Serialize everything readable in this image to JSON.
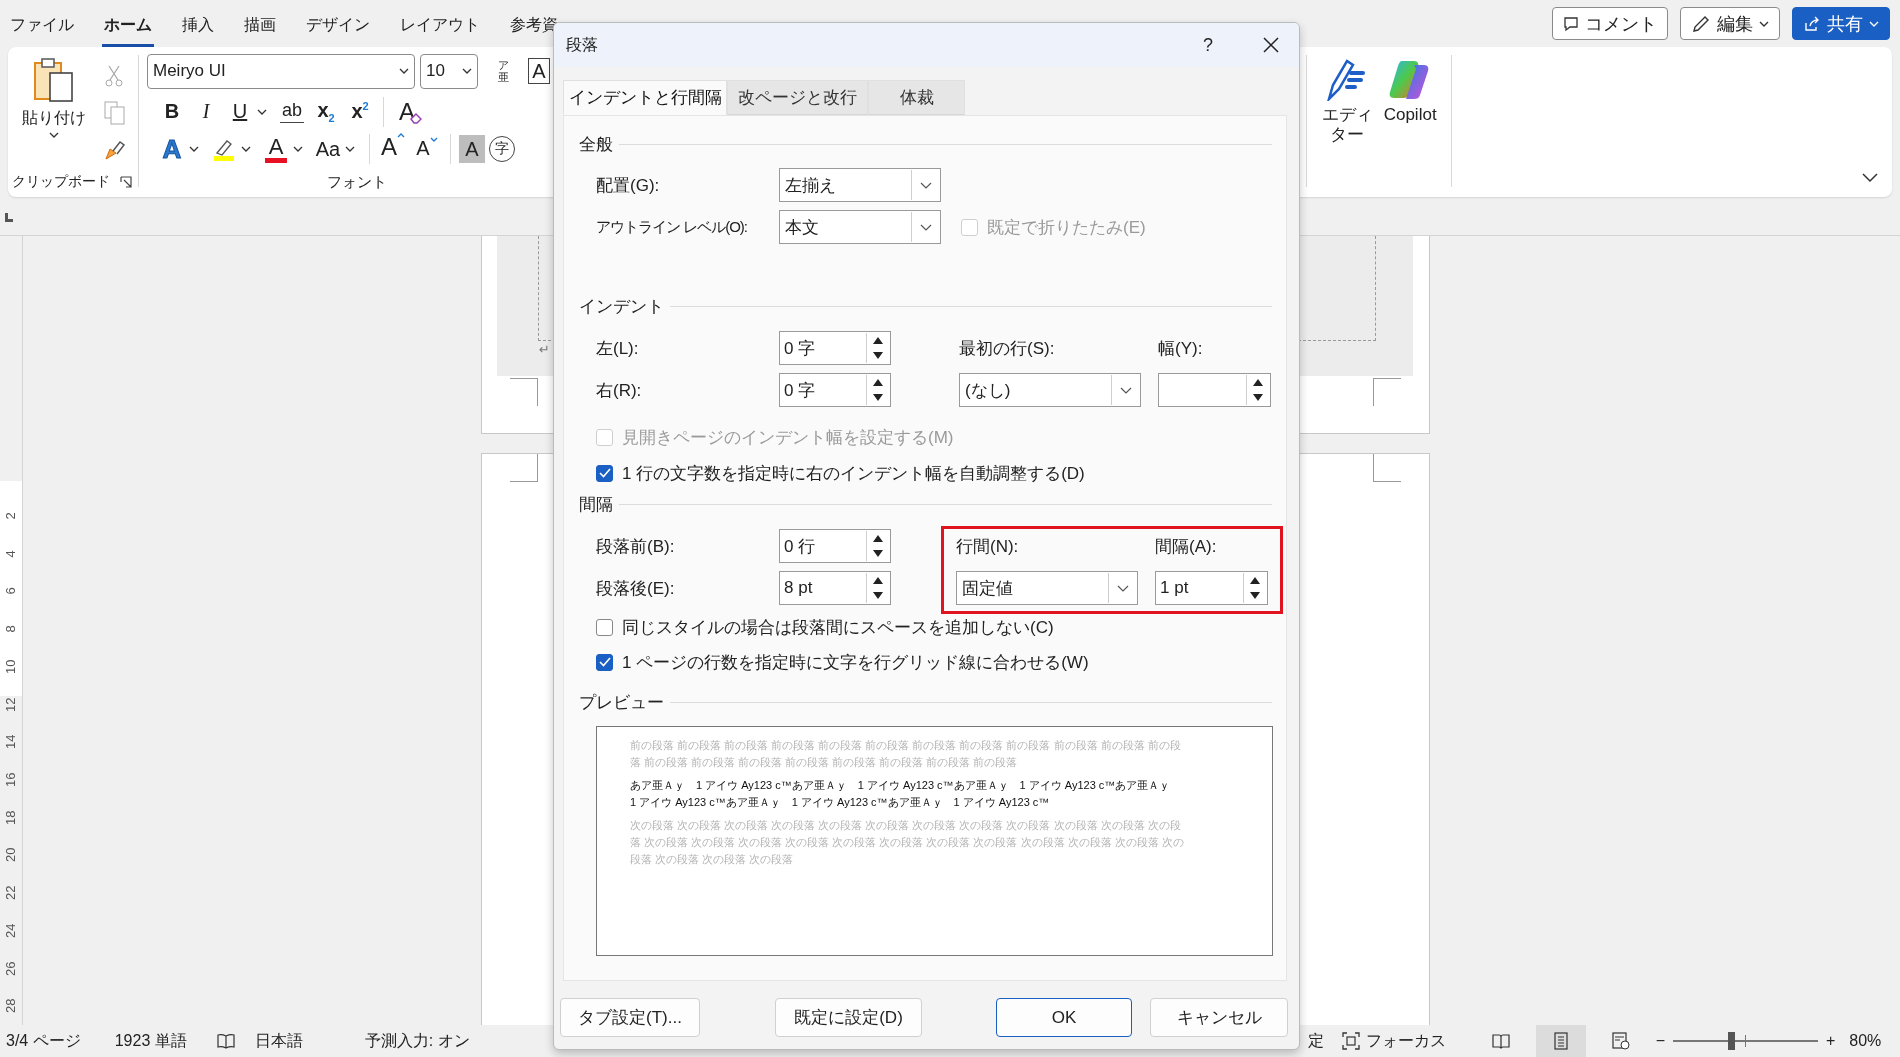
{
  "menu_tabs": [
    {
      "label": "ファイル",
      "selected": false
    },
    {
      "label": "ホーム",
      "selected": true
    },
    {
      "label": "挿入",
      "selected": false
    },
    {
      "label": "描画",
      "selected": false
    },
    {
      "label": "デザイン",
      "selected": false
    },
    {
      "label": "レイアウト",
      "selected": false
    },
    {
      "label": "参考資",
      "selected": false
    }
  ],
  "top_buttons": [
    {
      "kind": "comment",
      "label": "コメント"
    },
    {
      "kind": "edit",
      "label": "編集"
    },
    {
      "kind": "share",
      "label": "共有"
    }
  ],
  "ribbon": {
    "clipboard": {
      "paste": "貼り付け",
      "group_label": "クリップボード"
    },
    "font": {
      "font_name": "Meiryo UI",
      "font_size": "10",
      "ruby_top": "ア",
      "ruby_bottom": "亜",
      "border_label": "A",
      "group_label": "フォント",
      "row_1": [
        {
          "kind": "bold",
          "label": "B",
          "dropdown": false
        },
        {
          "kind": "italic",
          "label": "I",
          "dropdown": false
        },
        {
          "kind": "underline",
          "label": "U",
          "dropdown": true
        },
        {
          "kind": "strike",
          "label": "ab",
          "dropdown": false
        },
        {
          "kind": "subscript",
          "label": "x$_{2}$",
          "dropdown": false
        },
        {
          "kind": "superscript",
          "label": "x$^{2}$",
          "dropdown": false
        },
        {
          "kind": "clear",
          "label": "A",
          "dropdown": false
        }
      ],
      "row_2": [
        {
          "kind": "effects",
          "label": "A",
          "dropdown": true
        },
        {
          "kind": "highlight",
          "dropdown": true
        },
        {
          "kind": "color",
          "label": "A",
          "dropdown": true
        },
        {
          "kind": "case",
          "label": "Aa",
          "dropdown": true
        },
        {
          "kind": "grow",
          "label": "A",
          "dropdown": false
        },
        {
          "kind": "shrink",
          "label": "A",
          "dropdown": false
        },
        {
          "kind": "shade",
          "label": "A",
          "dropdown": false
        },
        {
          "kind": "enclose",
          "label": "字",
          "dropdown": false
        }
      ]
    },
    "editor": "エディター",
    "copilot": "Copilot"
  },
  "document": {
    "paragraph_mark": "↵",
    "ruler_numbers": [
      "2",
      "4",
      "6",
      "8",
      "10",
      "12",
      "14",
      "16",
      "18",
      "20",
      "22",
      "24",
      "26",
      "28"
    ]
  },
  "dialog": {
    "title": "段落",
    "help": "?",
    "tabs": [
      {
        "label": "インデントと行間隔",
        "selected": true
      },
      {
        "label": "改ページと改行",
        "selected": false
      },
      {
        "label": "体裁",
        "selected": false
      }
    ],
    "general": {
      "heading": "全般",
      "alignment": {
        "label": "配置(G):",
        "value": "左揃え"
      },
      "outline": {
        "label": "アウトライン レベル(O):",
        "value": "本文"
      },
      "collapse": {
        "label": "既定で折りたたみ(E)",
        "checked": false,
        "disabled": true
      }
    },
    "indent": {
      "heading": "インデント",
      "left": {
        "label": "左(L):",
        "value": "0 字"
      },
      "right": {
        "label": "右(R):",
        "value": "0 字"
      },
      "first_line": {
        "label": "最初の行(S):",
        "value": "(なし)"
      },
      "by": {
        "label": "幅(Y):"
      },
      "checks": [
        {
          "label": "見開きページのインデント幅を設定する(M)",
          "checked": false,
          "disabled": true
        },
        {
          "label": "1 行の文字数を指定時に右のインデント幅を自動調整する(D)",
          "checked": true,
          "disabled": false
        }
      ]
    },
    "spacing": {
      "heading": "間隔",
      "before": {
        "label": "段落前(B):",
        "value": "0 行"
      },
      "after": {
        "label": "段落後(E):",
        "value": "8 pt"
      },
      "line_spacing": {
        "label": "行間(N):",
        "value": "固定値"
      },
      "at": {
        "label": "間隔(A):",
        "value": "1 pt"
      },
      "highlighted": true,
      "checks": [
        {
          "label": "同じスタイルの場合は段落間にスペースを追加しない(C)",
          "checked": false,
          "disabled": false
        },
        {
          "label": "1 ページの行数を指定時に文字を行グリッド線に合わせる(W)",
          "checked": true,
          "disabled": false
        }
      ]
    },
    "preview": {
      "heading": "プレビュー",
      "previous": "前の段落 前の段落 前の段落 前の段落 前の段落 前の段落 前の段落 前の段落 前の段落 前の段落 前の段落 前の段落 前の段落 前の段落 前の段落 前の段落 前の段落 前の段落 前の段落 前の段落",
      "sample": "あア亜Ａｙ　1 アイウ Ay123 c™あア亜Ａｙ　1 アイウ Ay123 c™あア亜Ａｙ　1 アイウ Ay123 c™あア亜Ａｙ　1 アイウ Ay123 c™あア亜Ａｙ　1 アイウ Ay123 c™あア亜Ａｙ　1 アイウ Ay123 c™",
      "next": "次の段落 次の段落 次の段落 次の段落 次の段落 次の段落 次の段落 次の段落 次の段落 次の段落 次の段落 次の段落 次の段落 次の段落 次の段落 次の段落 次の段落 次の段落 次の段落 次の段落 次の段落 次の段落 次の段落 次の段落 次の段落 次の段落 次の段落"
    },
    "buttons": [
      {
        "label": "タブ設定(T)...",
        "default": false
      },
      {
        "label": "既定に設定(D)",
        "default": false
      },
      {
        "label": "OK",
        "default": true
      },
      {
        "label": "キャンセル",
        "default": false
      }
    ]
  },
  "status_bar": {
    "page_count": "3/4 ページ",
    "word_count": "1923 単語",
    "language": "日本語",
    "prediction": "予測入力: オン",
    "partial": "定",
    "focus": "フォーカス",
    "views": [
      {
        "kind": "read",
        "selected": false
      },
      {
        "kind": "print",
        "selected": true
      },
      {
        "kind": "web",
        "selected": false
      }
    ],
    "minus": "−",
    "plus": "+",
    "zoom": {
      "level": 0.4,
      "reading": "80%"
    }
  }
}
